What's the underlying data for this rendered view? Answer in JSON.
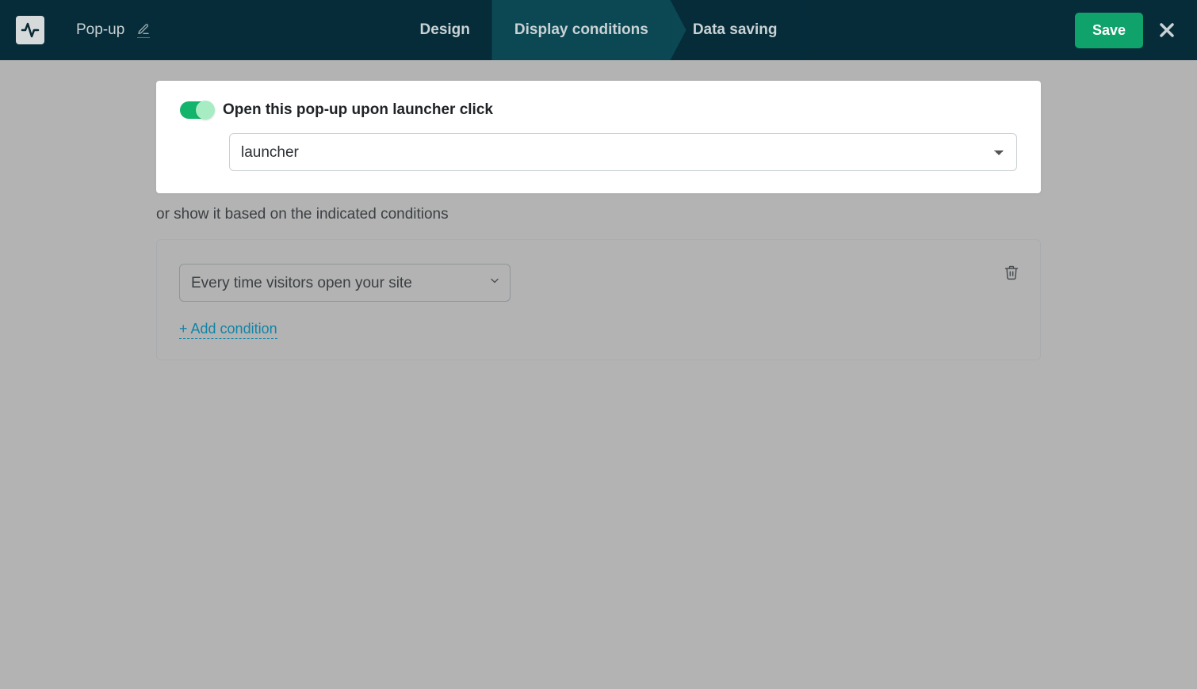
{
  "header": {
    "page_title": "Pop-up",
    "tabs": {
      "design": "Design",
      "display_conditions": "Display conditions",
      "data_saving": "Data saving"
    },
    "save_label": "Save"
  },
  "launcher": {
    "toggle_label": "Open this pop-up upon launcher click",
    "toggle_on": true,
    "select_value": "launcher"
  },
  "conditions": {
    "intro": "or show it based on the indicated conditions",
    "selected": "Every time visitors open your site",
    "add_link": "+ Add condition"
  }
}
